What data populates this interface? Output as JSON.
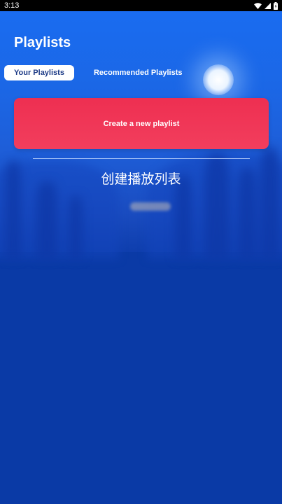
{
  "status_bar": {
    "time": "3:13",
    "icons": [
      "wifi-icon",
      "signal-icon",
      "battery-icon"
    ]
  },
  "header": {
    "title": "Playlists"
  },
  "tabs": [
    {
      "label": "Your Playlists",
      "active": true
    },
    {
      "label": "Recommended Playlists",
      "active": false
    }
  ],
  "create_card": {
    "label": "Create a new playlist"
  },
  "overlay": {
    "title": "创建播放列表"
  },
  "colors": {
    "accent_card": "#ee2f51",
    "background": "#0a3aa8",
    "tab_active_bg": "#ffffff",
    "tab_active_text": "#1c3a86"
  }
}
